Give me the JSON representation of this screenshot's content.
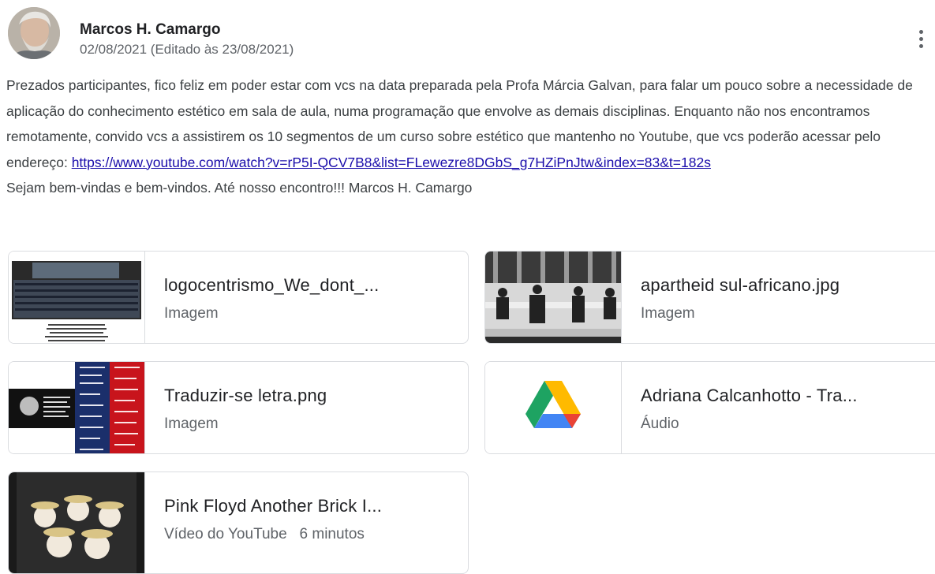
{
  "post": {
    "author": "Marcos H. Camargo",
    "date": "02/08/2021 (Editado às 23/08/2021)",
    "body_before_link": "Prezados participantes, fico feliz em poder estar com vcs na data preparada pela Profa Márcia Galvan, para falar um pouco sobre a necessidade de aplicação do conhecimento estético em sala de aula, numa programação que envolve as demais disciplinas. Enquanto não nos encontramos remotamente, convido vcs a assistirem os 10 segmentos de um curso sobre estético que mantenho no Youtube, que vcs poderão acessar pelo endereço: ",
    "link_text": "https://www.youtube.com/watch?v=rP5I-QCV7B8&list=FLewezre8DGbS_g7HZiPnJtw&index=83&t=182s",
    "closing": "Sejam bem-vindas e bem-vindos. Até nosso encontro!!! Marcos H. Camargo"
  },
  "attachments": [
    {
      "title": "logocentrismo_We_dont_...",
      "type": "Imagem",
      "icon": "image-thumbnail"
    },
    {
      "title": "apartheid sul-africano.jpg",
      "type": "Imagem",
      "icon": "image-thumbnail"
    },
    {
      "title": "Traduzir-se letra.png",
      "type": "Imagem",
      "icon": "image-thumbnail"
    },
    {
      "title": "Adriana Calcanhotto - Tra...",
      "type": "Áudio",
      "icon": "google-drive-icon"
    },
    {
      "title": "Pink Floyd Another Brick I...",
      "type": "Vídeo do YouTube",
      "duration": "6 minutos",
      "icon": "video-thumbnail"
    }
  ],
  "colors": {
    "link": "#1a0dab",
    "border": "#dadce0",
    "drive_green": "#1ea362",
    "drive_yellow": "#ffba00",
    "drive_blue": "#4285f4",
    "drive_red": "#ea4335"
  }
}
